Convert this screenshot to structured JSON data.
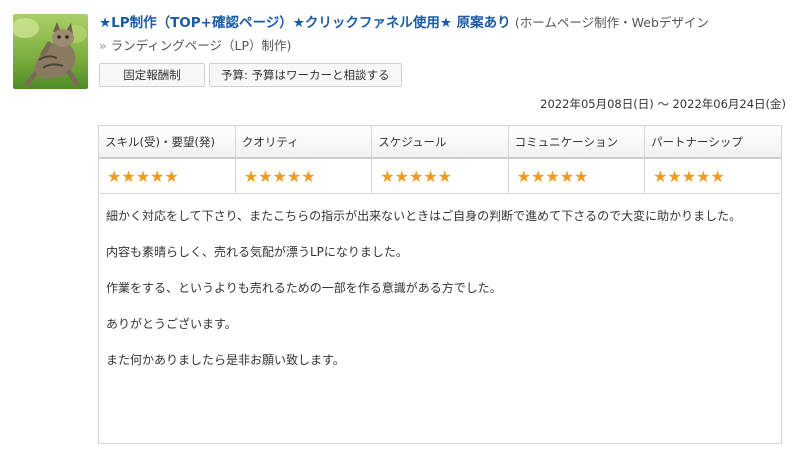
{
  "project": {
    "title": "★LP制作（TOP+確認ページ）★クリックファネル使用★ 原案あり",
    "category": "(ホームページ制作・Webデザイン",
    "subcategory_sep": "»",
    "subcategory": "ランディングページ（LP）制作)",
    "contract_type": "固定報酬制",
    "budget": "予算: 予算はワーカーと相談する",
    "date_range": "2022年05月08日(日) ～ 2022年06月24日(金)"
  },
  "thumbnail": {
    "icon": "cat-photo-icon"
  },
  "ratings": {
    "columns": [
      {
        "label": "スキル(受)・要望(発)",
        "stars": "★★★★★",
        "score": 5
      },
      {
        "label": "クオリティ",
        "stars": "★★★★★",
        "score": 5
      },
      {
        "label": "スケジュール",
        "stars": "★★★★★",
        "score": 5
      },
      {
        "label": "コミュニケーション",
        "stars": "★★★★★",
        "score": 5
      },
      {
        "label": "パートナーシップ",
        "stars": "★★★★★",
        "score": 5
      }
    ],
    "star_color": "#f29a1f"
  },
  "comment": {
    "paragraphs": [
      "細かく対応をして下さり、またこちらの指示が出来ないときはご自身の判断で進めて下さるので大変に助かりました。",
      "内容も素晴らしく、売れる気配が漂うLPになりました。",
      "作業をする、というよりも売れるための一部を作る意識がある方でした。",
      "ありがとうございます。",
      "また何かありましたら是非お願い致します。"
    ]
  },
  "colors": {
    "title_link": "#1a5ba6",
    "border": "#d6d6d6"
  }
}
